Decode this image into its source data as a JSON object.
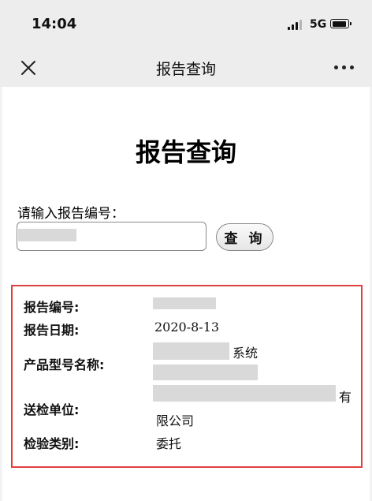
{
  "status_bar": {
    "time": "14:04",
    "network": "5G"
  },
  "nav": {
    "title": "报告查询",
    "close_icon": "close-icon",
    "more_icon": "more-dots-icon"
  },
  "page": {
    "heading": "报告查询",
    "input_label": "请输入报告编号：",
    "input_value": "",
    "query_button": "查 询"
  },
  "result": {
    "report_no_label": "报告编号:",
    "report_date_label": "报告日期:",
    "report_date": "2020-8-13",
    "product_label": "产品型号名称:",
    "product_suffix": "系统",
    "sender_label": "送检单位:",
    "sender_suffix": "有",
    "sender_line2": "限公司",
    "category_label": "检验类别:",
    "category": "委托"
  },
  "colors": {
    "highlight_border": "#e0403f",
    "nav_bg": "#ededed",
    "mask": "#d9d9d9"
  }
}
